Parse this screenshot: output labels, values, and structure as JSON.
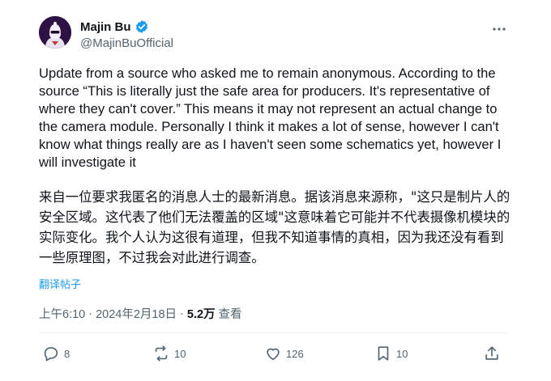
{
  "author": {
    "name": "Majin Bu",
    "handle": "@MajinBuOfficial"
  },
  "tweet": {
    "text_en": "Update from a source who asked me to remain anonymous. According to the source “This is literally just the safe area for producers. It's representative of where they can't cover.” This means it may not represent an actual change to the camera module. Personally I think it makes a lot of sense, however I can't know what things really are as I haven't seen some schematics yet, however I will investigate it",
    "text_zh": "来自一位要求我匿名的消息人士的最新消息。据该消息来源称，\"这只是制片人的安全区域。这代表了他们无法覆盖的区域\"这意味着它可能并不代表摄像机模块的实际变化。我个人认为这很有道理，但我不知道事情的真相，因为我还没有看到一些原理图，不过我会对此进行调查。",
    "translate_label": "翻译帖子"
  },
  "meta": {
    "time": "上午6:10",
    "separator": "·",
    "date": "2024年2月18日",
    "views_count": "5.2万",
    "views_label": "查看"
  },
  "actions": {
    "replies": "8",
    "reposts": "10",
    "likes": "126",
    "bookmarks": "10"
  },
  "colors": {
    "accent": "#1d9bf0",
    "text_primary": "#0f1419",
    "text_secondary": "#536471"
  }
}
